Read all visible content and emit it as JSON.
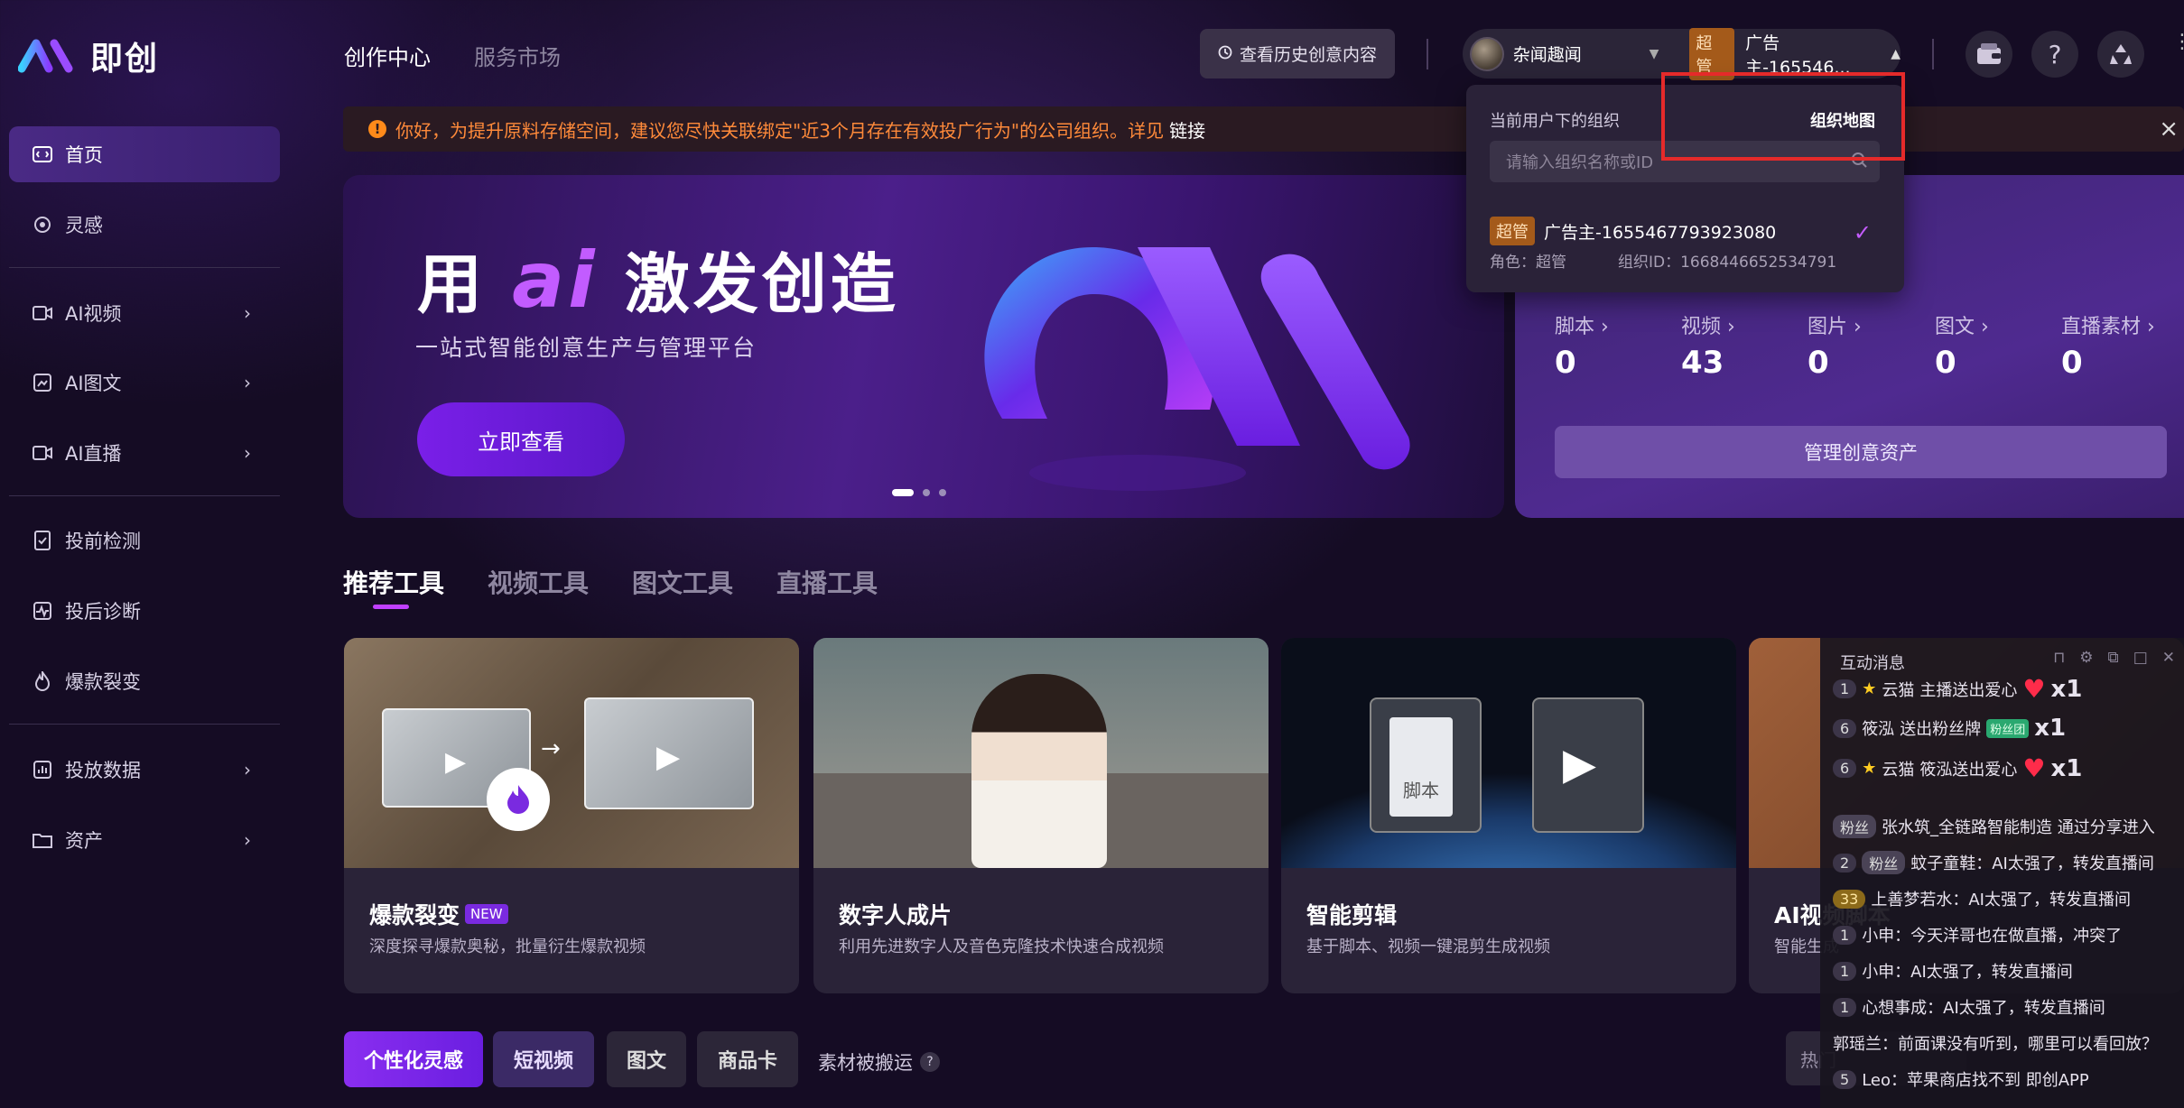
{
  "app": {
    "name": "即创"
  },
  "sidebar": {
    "items": [
      {
        "label": "首页",
        "icon": "home-icon"
      },
      {
        "label": "灵感",
        "icon": "lightbulb-icon"
      },
      {
        "label": "AI视频",
        "icon": "video-icon"
      },
      {
        "label": "AI图文",
        "icon": "image-text-icon"
      },
      {
        "label": "AI直播",
        "icon": "live-icon"
      },
      {
        "label": "投前检测",
        "icon": "document-check-icon"
      },
      {
        "label": "投后诊断",
        "icon": "diagnosis-icon"
      },
      {
        "label": "爆款裂变",
        "icon": "fire-icon"
      },
      {
        "label": "投放数据",
        "icon": "data-icon"
      },
      {
        "label": "资产",
        "icon": "folder-icon"
      }
    ]
  },
  "header": {
    "tabs": [
      "创作中心",
      "服务市场"
    ],
    "history_btn": "查看历史创意内容",
    "account": "杂闻趣闻",
    "role_badge": "超管",
    "org": "广告主-165546..."
  },
  "notice": {
    "text": "你好，为提升原料存储空间，建议您尽快关联绑定\"近3个月存在有效投广行为\"的公司组织。详见",
    "link": "链接"
  },
  "banner": {
    "title_pre": "用",
    "title_ai": "ai",
    "title_post": "激发创造",
    "subtitle": "一站式智能创意生产与管理平台",
    "cta": "立即查看"
  },
  "assets": {
    "stats": [
      {
        "label": "脚本",
        "value": "0"
      },
      {
        "label": "视频",
        "value": "43"
      },
      {
        "label": "图片",
        "value": "0"
      },
      {
        "label": "图文",
        "value": "0"
      },
      {
        "label": "直播素材",
        "value": "0"
      }
    ],
    "manage_btn": "管理创意资产"
  },
  "dropdown": {
    "title": "当前用户下的组织",
    "map_link": "组织地图",
    "search_placeholder": "请输入组织名称或ID",
    "org_badge": "超管",
    "org_name": "广告主-1655467793923080",
    "role": "角色：超管",
    "org_id": "组织ID：1668446652534791"
  },
  "tool_tabs": [
    "推荐工具",
    "视频工具",
    "图文工具",
    "直播工具"
  ],
  "cards": [
    {
      "title": "爆款裂变",
      "tag": "NEW",
      "desc": "深度探寻爆款奥秘，批量衍生爆款视频"
    },
    {
      "title": "数字人成片",
      "desc": "利用先进数字人及音色克隆技术快速合成视频"
    },
    {
      "title": "智能剪辑",
      "desc": "基于脚本、视频一键混剪生成视频",
      "doc_label": "脚本"
    },
    {
      "title": "AI视频脚本",
      "desc": "智能生成"
    }
  ],
  "bottom": {
    "buttons": [
      "个性化灵感",
      "短视频",
      "图文",
      "商品卡"
    ],
    "moved": "素材被搬运",
    "hot": "热门"
  },
  "chat": {
    "title": "互动消息",
    "messages": [
      {
        "lv": "1",
        "name": "云猫",
        "text": "主播送出爱心",
        "x": "x1"
      },
      {
        "lv": "6",
        "name": "筱泓",
        "text": "送出粉丝牌",
        "x": "x1"
      },
      {
        "lv": "6",
        "name": "云猫",
        "text": "筱泓送出爱心",
        "x": "x1"
      },
      {
        "fan": "粉丝",
        "text": "张水筑_全链路智能制造 通过分享进入"
      },
      {
        "lv": "2",
        "fan": "粉丝",
        "text": "蚊子童鞋：AI太强了，转发直播间"
      },
      {
        "lv": "33",
        "gold": true,
        "text": "上善梦若水：AI太强了，转发直播间"
      },
      {
        "lv": "1",
        "text": "小申：今天洋哥也在做直播，冲突了"
      },
      {
        "lv": "1",
        "text": "小申：AI太强了，转发直播间"
      },
      {
        "lv": "1",
        "text": "心想事成：AI太强了，转发直播间"
      },
      {
        "text": "郭瑶兰：前面课没有听到，哪里可以看回放？"
      },
      {
        "lv": "5",
        "text": "Leo：苹果商店找不到 即创APP"
      }
    ]
  }
}
